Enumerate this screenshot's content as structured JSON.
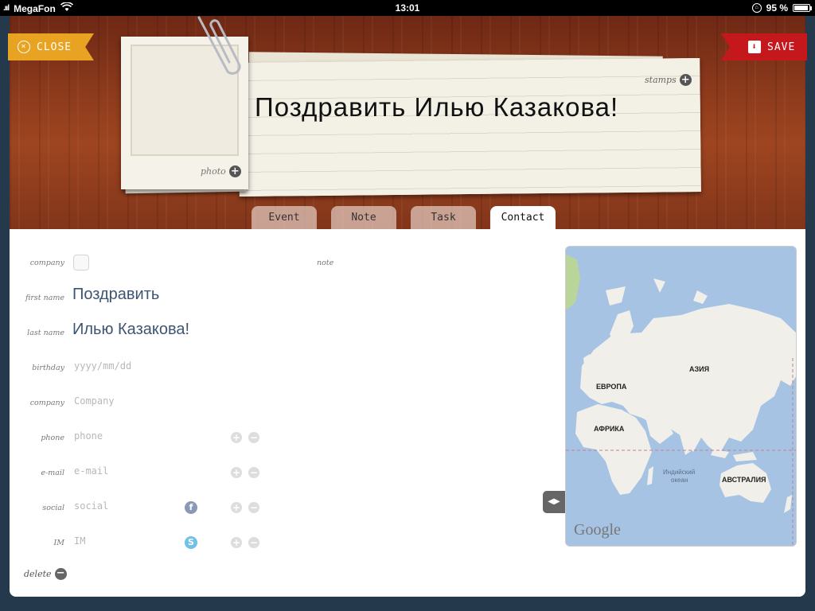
{
  "status_bar": {
    "carrier": "MegaFon",
    "time": "13:01",
    "battery": "95 %",
    "battery_level": 0.95
  },
  "header": {
    "close_label": "CLOSE",
    "save_label": "SAVE",
    "title": "Поздравить Илью Казакова!",
    "stamps_label": "stamps",
    "photo_label": "photo"
  },
  "tabs": [
    {
      "label": "Event",
      "active": false
    },
    {
      "label": "Note",
      "active": false
    },
    {
      "label": "Task",
      "active": false
    },
    {
      "label": "Contact",
      "active": true
    }
  ],
  "form": {
    "company_checkbox_label": "company",
    "first_name_label": "first name",
    "first_name_value": "Поздравить",
    "last_name_label": "last name",
    "last_name_value": "Илью Казакова!",
    "birthday_label": "birthday",
    "birthday_placeholder": "yyyy/mm/dd",
    "company_label": "company",
    "company_placeholder": "Company",
    "phone_label": "phone",
    "phone_placeholder": "phone",
    "email_label": "e-mail",
    "email_placeholder": "e-mail",
    "social_label": "social",
    "social_placeholder": "social",
    "im_label": "IM",
    "im_placeholder": "IM",
    "delete_label": "delete",
    "note_label": "note"
  },
  "map": {
    "labels": {
      "europe": "ЕВРОПА",
      "asia": "АЗИЯ",
      "africa": "АФРИКА",
      "australia": "АВСТРАЛИЯ",
      "indian_ocean_1": "Индийский",
      "indian_ocean_2": "океан"
    },
    "logo": "Google"
  },
  "colors": {
    "close_ribbon": "#e8a322",
    "save_ribbon": "#c5181c",
    "field_value": "#3d5572",
    "map_water": "#a7c3e3",
    "map_land": "#f1efe9"
  }
}
